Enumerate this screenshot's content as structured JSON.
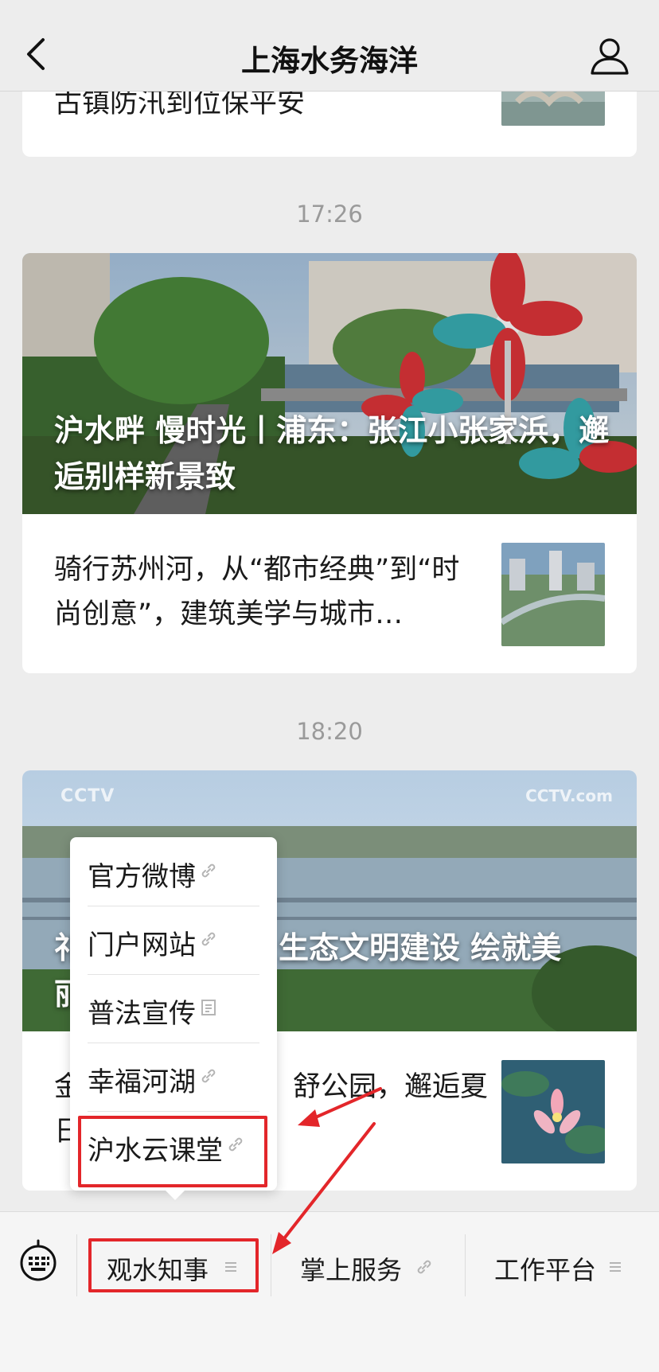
{
  "header": {
    "title": "上海水务海洋",
    "back_icon": "chevron-left-icon",
    "profile_icon": "person-icon"
  },
  "feed": {
    "prev_card": {
      "title": "古镇防汛到位保平安"
    },
    "groups": [
      {
        "time": "17:26",
        "cover_title": "沪水畔 慢时光丨浦东：张江小张家浜，邂逅别样新景致",
        "sub_title": "骑行苏州河，从“都市经典”到“时尚创意”，建筑美学与城市…"
      },
      {
        "time": "18:20",
        "cover_title_visible_left": "祁",
        "cover_title_visible_right": "生态文明建设 绘就美",
        "cover_title_line2_left": "丽",
        "sub_title_left": "金",
        "sub_title_right": "舒公园，邂逅夏",
        "sub_title_line2_left": "日",
        "watermark_left": "CCTV",
        "watermark_right": "CCTV.com"
      }
    ]
  },
  "popup": {
    "items": [
      {
        "label": "官方微博",
        "icon": "link-icon"
      },
      {
        "label": "门户网站",
        "icon": "link-icon"
      },
      {
        "label": "普法宣传",
        "icon": "article-icon"
      },
      {
        "label": "幸福河湖",
        "icon": "link-icon"
      },
      {
        "label": "沪水云课堂",
        "icon": "link-icon"
      }
    ]
  },
  "bottom_bar": {
    "keyboard_icon": "keyboard-icon",
    "menus": [
      {
        "label": "观水知事",
        "icon": "menu-lines-icon"
      },
      {
        "label": "掌上服务",
        "icon": "link-icon"
      },
      {
        "label": "工作平台",
        "icon": "menu-lines-icon"
      }
    ]
  },
  "colors": {
    "background": "#ededed",
    "card": "#ffffff",
    "annotation_red": "#e3262a",
    "time_gray": "#9a9a9a"
  }
}
